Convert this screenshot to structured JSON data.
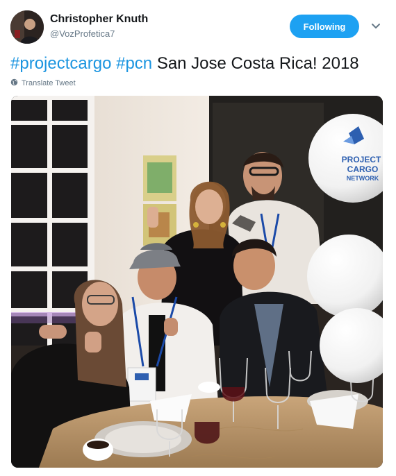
{
  "user": {
    "display_name": "Christopher Knuth",
    "handle": "@VozProfetica7",
    "follow_button_label": "Following"
  },
  "tweet": {
    "hashtags": [
      "#projectcargo",
      "#pcn"
    ],
    "text": "San Jose Costa Rica! 2018",
    "translate_label": "Translate Tweet"
  },
  "photo": {
    "balloon_logo_lines": [
      "PROJECT",
      "CARGO",
      "NETWORK"
    ]
  },
  "colors": {
    "accent": "#1da1f2",
    "hashtag": "#1b95e0",
    "secondary_text": "#657786",
    "primary_text": "#14171a"
  },
  "icons": {
    "more": "chevron-down-icon",
    "translate": "globe-icon"
  }
}
